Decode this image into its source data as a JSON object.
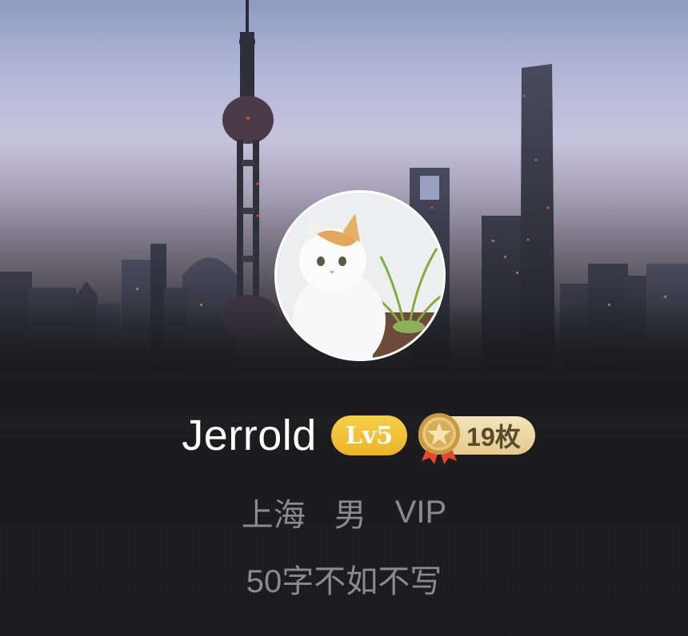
{
  "profile": {
    "username": "Jerrold",
    "level_label": "Lv5",
    "medal_count": "19枚",
    "location": "上海",
    "gender": "男",
    "membership": "VIP",
    "bio": "50字不如不写"
  },
  "icons": {
    "medal": "medal-star-icon",
    "avatar": "cat-avatar-photo"
  },
  "colors": {
    "level_badge": "#efbf31",
    "medal_badge": "#ecd6a1",
    "secondary_text": "#8a8a8f",
    "name_text": "#ffffff"
  }
}
